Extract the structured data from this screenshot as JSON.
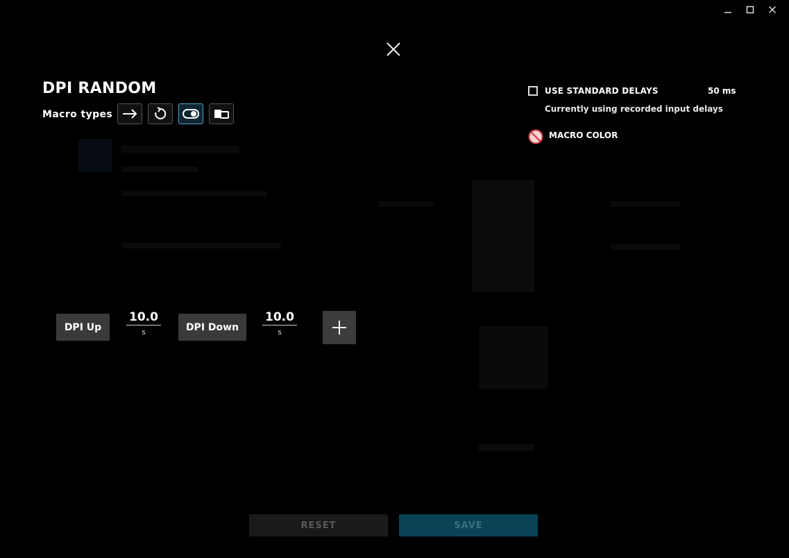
{
  "window": {
    "minimize_icon": "minimize-icon",
    "maximize_icon": "maximize-icon",
    "close_icon": "close-icon"
  },
  "dialog": {
    "title": "DPI RANDOM",
    "macro_types_label": "Macro types",
    "macro_types": [
      {
        "icon": "arrow-right-icon",
        "active": false
      },
      {
        "icon": "repeat-icon",
        "active": false
      },
      {
        "icon": "toggle-icon",
        "active": true
      },
      {
        "icon": "sequence-icon",
        "active": false
      }
    ]
  },
  "settings": {
    "use_standard_delays_label": "USE STANDARD DELAYS",
    "use_standard_delays_checked": false,
    "delay_value": "50 ms",
    "recorded_note": "Currently using recorded input delays",
    "macro_color_label": "MACRO COLOR",
    "macro_color_icon": "no-color-icon"
  },
  "sequence": {
    "items": [
      {
        "type": "action",
        "label": "DPI Up"
      },
      {
        "type": "delay",
        "value": "10.0",
        "unit": "s"
      },
      {
        "type": "action",
        "label": "DPI Down"
      },
      {
        "type": "delay",
        "value": "10.0",
        "unit": "s"
      }
    ],
    "add_icon": "plus-icon"
  },
  "footer": {
    "reset_label": "RESET",
    "save_label": "SAVE"
  },
  "colors": {
    "background": "#000000",
    "accent": "#4ea3c7",
    "save_bg": "#0b4356",
    "action_bg": "#3a3a3a"
  }
}
